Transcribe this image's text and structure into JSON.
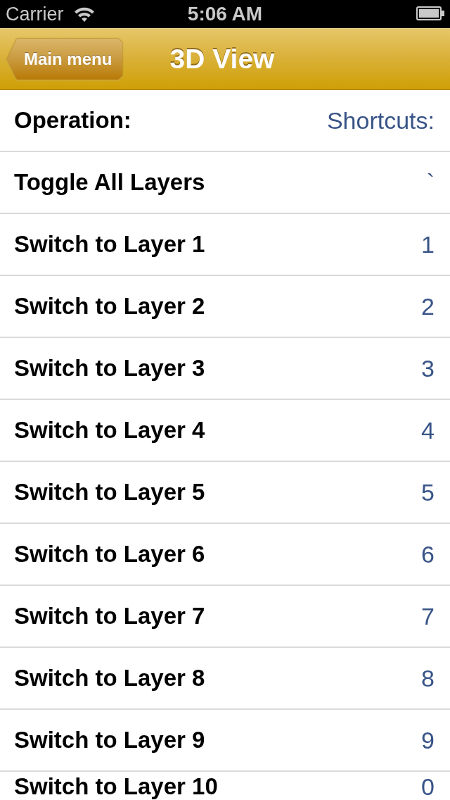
{
  "status_bar": {
    "carrier": "Carrier",
    "time": "5:06 AM"
  },
  "nav_bar": {
    "back_button": "Main menu",
    "title": "3D View"
  },
  "header": {
    "operation": "Operation:",
    "shortcut": "Shortcuts:"
  },
  "rows": [
    {
      "operation": "Toggle All Layers",
      "shortcut": "`"
    },
    {
      "operation": "Switch to Layer 1",
      "shortcut": "1"
    },
    {
      "operation": "Switch to Layer 2",
      "shortcut": "2"
    },
    {
      "operation": "Switch to Layer 3",
      "shortcut": "3"
    },
    {
      "operation": "Switch to Layer 4",
      "shortcut": "4"
    },
    {
      "operation": "Switch to Layer 5",
      "shortcut": "5"
    },
    {
      "operation": "Switch to Layer 6",
      "shortcut": "6"
    },
    {
      "operation": "Switch to Layer 7",
      "shortcut": "7"
    },
    {
      "operation": "Switch to Layer 8",
      "shortcut": "8"
    },
    {
      "operation": "Switch to Layer 9",
      "shortcut": "9"
    },
    {
      "operation": "Switch to Layer 10",
      "shortcut": "0"
    }
  ]
}
